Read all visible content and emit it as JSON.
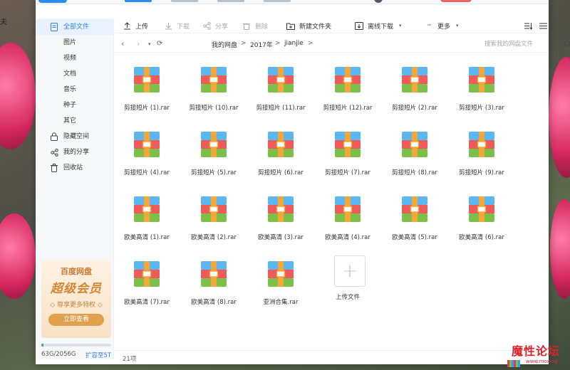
{
  "sidebar": {
    "items": [
      {
        "label": "全部文件",
        "icon": "document-icon"
      },
      {
        "label": "图片"
      },
      {
        "label": "视频"
      },
      {
        "label": "文档"
      },
      {
        "label": "音乐"
      },
      {
        "label": "种子"
      },
      {
        "label": "其它"
      },
      {
        "label": "隐藏空间",
        "icon": "lock-icon"
      },
      {
        "label": "我的分享",
        "icon": "share-icon"
      },
      {
        "label": "回收站",
        "icon": "trash-icon"
      }
    ],
    "promo": {
      "brand": "百度网盘",
      "title": "超级会员",
      "subtitle": "◇ 尊享更多特权 ◇",
      "button": "立即查看"
    },
    "storage": {
      "used_text": "63G/2056G",
      "used_fraction": 0.031,
      "expand": "扩容至5T"
    }
  },
  "toolbar": {
    "upload": "上传",
    "download": "下载",
    "share": "分享",
    "delete": "删除",
    "new_folder": "新建文件夹",
    "offline_download": "离线下载",
    "more": "更多"
  },
  "path": {
    "crumbs": [
      "我的网盘",
      "2017年",
      "jianjie"
    ],
    "separator": ">",
    "search_placeholder": "搜索我的网盘文件"
  },
  "files": [
    "剪接短片 (1).rar",
    "剪接短片 (10).rar",
    "剪接短片 (11).rar",
    "剪接短片 (12).rar",
    "剪接短片 (2).rar",
    "剪接短片 (3).rar",
    "剪接短片 (4).rar",
    "剪接短片 (5).rar",
    "剪接短片 (6).rar",
    "剪接短片 (7).rar",
    "剪接短片 (8).rar",
    "剪接短片 (9).rar",
    "欧美高清 (1).rar",
    "欧美高清 (2).rar",
    "欧美高清 (3).rar",
    "欧美高清 (4).rar",
    "欧美高清 (5).rar",
    "欧美高清 (6).rar",
    "欧美高清 (7).rar",
    "欧美高清 (8).rar",
    "亚洲合集.rar"
  ],
  "upload_tile": "上传文件",
  "footer": {
    "count": "21项"
  },
  "watermark": {
    "text": "魔性论坛",
    "url": "www.moxing"
  },
  "colors": {
    "accent": "#2f7fe5",
    "zip_blue": "#5cb6f0",
    "zip_red": "#ef5b5b",
    "zip_green": "#7cc04a",
    "zip_strap": "#f2a73b"
  }
}
